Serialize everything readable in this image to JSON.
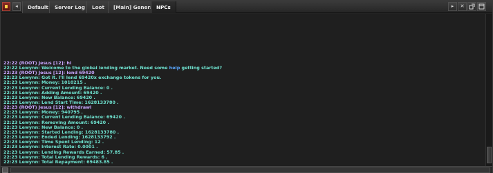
{
  "tabs": [
    {
      "label": "Default"
    },
    {
      "label": "Server Log"
    },
    {
      "label": "Loot"
    },
    {
      "label": "[Main] General"
    },
    {
      "label": "NPCs"
    }
  ],
  "window_buttons": {
    "prev": "◂",
    "next": "▸",
    "close_x": "✕"
  },
  "chat": {
    "lines": [
      {
        "time": "22:22",
        "speaker": "(ROOT) Jesus [12]:",
        "text": " hi",
        "type": "root"
      },
      {
        "time": "22:22",
        "speaker": "Lewynn:",
        "text": " Welcome to the global lending market. Need some ",
        "link": "help",
        "after": " getting started?",
        "type": "npc"
      },
      {
        "time": "22:23",
        "speaker": "(ROOT) Jesus [12]:",
        "text": " lend 69420",
        "type": "root"
      },
      {
        "time": "22:23",
        "speaker": "Lewynn:",
        "text": " Got it. I'll lend 69420x exchange tokens for you.",
        "type": "npc"
      },
      {
        "time": "22:23",
        "speaker": "Lewynn:",
        "text": " Money: 1010215 .",
        "type": "npc"
      },
      {
        "time": "22:23",
        "speaker": "Lewynn:",
        "text": " Current Lending Balance: 0 .",
        "type": "npc"
      },
      {
        "time": "22:23",
        "speaker": "Lewynn:",
        "text": " Adding Amount: 69420 .",
        "type": "npc"
      },
      {
        "time": "22:23",
        "speaker": "Lewynn:",
        "text": " New Balance: 69420 .",
        "type": "npc"
      },
      {
        "time": "22:23",
        "speaker": "Lewynn:",
        "text": " Lend Start Time: 1628133780 .",
        "type": "npc"
      },
      {
        "time": "22:23",
        "speaker": "(ROOT) Jesus [12]:",
        "text": " withdrawl",
        "type": "root"
      },
      {
        "time": "22:23",
        "speaker": "Lewynn:",
        "text": " Money: 940795 .",
        "type": "npc"
      },
      {
        "time": "22:23",
        "speaker": "Lewynn:",
        "text": " Current Lending Balance: 69420 .",
        "type": "npc"
      },
      {
        "time": "22:23",
        "speaker": "Lewynn:",
        "text": " Removing Amount: 69420 .",
        "type": "npc"
      },
      {
        "time": "22:23",
        "speaker": "Lewynn:",
        "text": " New Balance: 0 .",
        "type": "npc"
      },
      {
        "time": "22:23",
        "speaker": "Lewynn:",
        "text": " Started Lending: 1628133780 .",
        "type": "npc"
      },
      {
        "time": "22:23",
        "speaker": "Lewynn:",
        "text": " Ended Lending: 1628133792 .",
        "type": "npc"
      },
      {
        "time": "22:23",
        "speaker": "Lewynn:",
        "text": " Time Spent Lending: 12 .",
        "type": "npc"
      },
      {
        "time": "22:23",
        "speaker": "Lewynn:",
        "text": " Interest Rate: 0.0001 .",
        "type": "npc"
      },
      {
        "time": "22:23",
        "speaker": "Lewynn:",
        "text": " Lending Rewards Earned: 57.85 .",
        "type": "npc"
      },
      {
        "time": "22:23",
        "speaker": "Lewynn:",
        "text": " Total Lending Rewards: 6 .",
        "type": "npc"
      },
      {
        "time": "22:23",
        "speaker": "Lewynn:",
        "text": " Total Repayment: 69483.85 .",
        "type": "npc"
      }
    ]
  },
  "input": {
    "value": ""
  },
  "colors": {
    "npc": "#6fe3d0",
    "root": "#c9a7ff",
    "link": "#5aa7ff"
  }
}
